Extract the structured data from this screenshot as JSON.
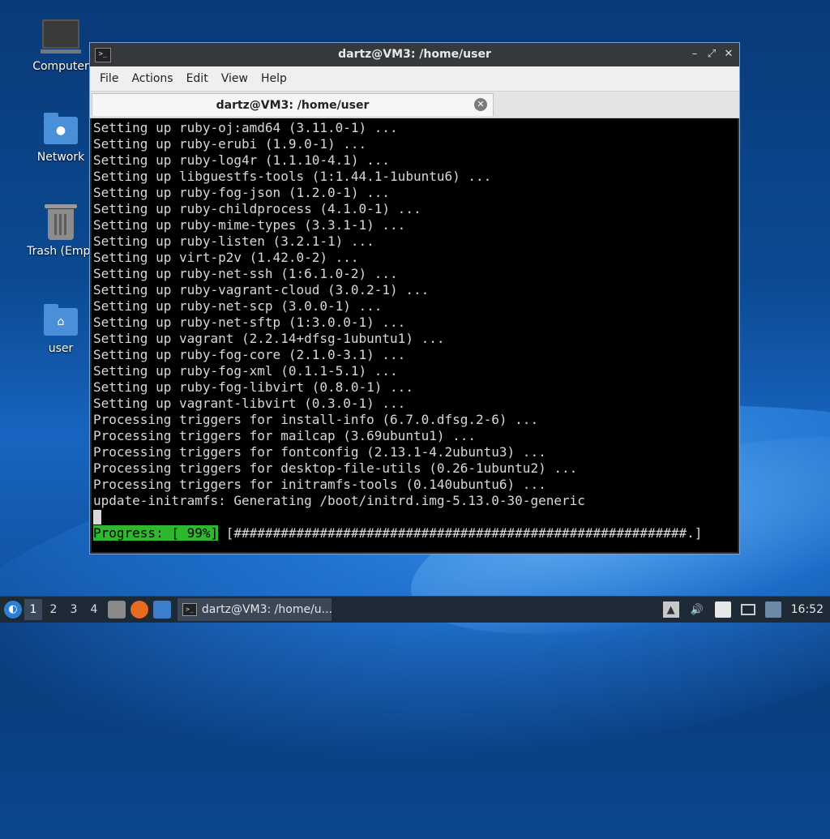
{
  "desktop": {
    "icons": [
      {
        "label": "Computer"
      },
      {
        "label": "Network"
      },
      {
        "label": "Trash (Empt"
      },
      {
        "label": "user"
      }
    ]
  },
  "window": {
    "title": "dartz@VM3: /home/user",
    "menu": [
      "File",
      "Actions",
      "Edit",
      "View",
      "Help"
    ],
    "tab_label": "dartz@VM3: /home/user",
    "controls": {
      "minimize": "–",
      "restore": "⤢",
      "close": "✕"
    }
  },
  "terminal": {
    "lines": [
      "Setting up ruby-oj:amd64 (3.11.0-1) ...",
      "Setting up ruby-erubi (1.9.0-1) ...",
      "Setting up ruby-log4r (1.1.10-4.1) ...",
      "Setting up libguestfs-tools (1:1.44.1-1ubuntu6) ...",
      "Setting up ruby-fog-json (1.2.0-1) ...",
      "Setting up ruby-childprocess (4.1.0-1) ...",
      "Setting up ruby-mime-types (3.3.1-1) ...",
      "Setting up ruby-listen (3.2.1-1) ...",
      "Setting up virt-p2v (1.42.0-2) ...",
      "Setting up ruby-net-ssh (1:6.1.0-2) ...",
      "Setting up ruby-vagrant-cloud (3.0.2-1) ...",
      "Setting up ruby-net-scp (3.0.0-1) ...",
      "Setting up ruby-net-sftp (1:3.0.0-1) ...",
      "Setting up vagrant (2.2.14+dfsg-1ubuntu1) ...",
      "Setting up ruby-fog-core (2.1.0-3.1) ...",
      "Setting up ruby-fog-xml (0.1.1-5.1) ...",
      "Setting up ruby-fog-libvirt (0.8.0-1) ...",
      "Setting up vagrant-libvirt (0.3.0-1) ...",
      "Processing triggers for install-info (6.7.0.dfsg.2-6) ...",
      "Processing triggers for mailcap (3.69ubuntu1) ...",
      "Processing triggers for fontconfig (2.13.1-4.2ubuntu3) ...",
      "Processing triggers for desktop-file-utils (0.26-1ubuntu2) ...",
      "Processing triggers for initramfs-tools (0.140ubuntu6) ...",
      "update-initramfs: Generating /boot/initrd.img-5.13.0-30-generic"
    ],
    "progress_label": "Progress: [ 99%]",
    "progress_bar": "[##########################################################.]",
    "progress_percent": 99
  },
  "taskbar": {
    "workspaces": [
      "1",
      "2",
      "3",
      "4"
    ],
    "active_workspace": "1",
    "task_label": "dartz@VM3: /home/u...",
    "clock": "16:52"
  }
}
